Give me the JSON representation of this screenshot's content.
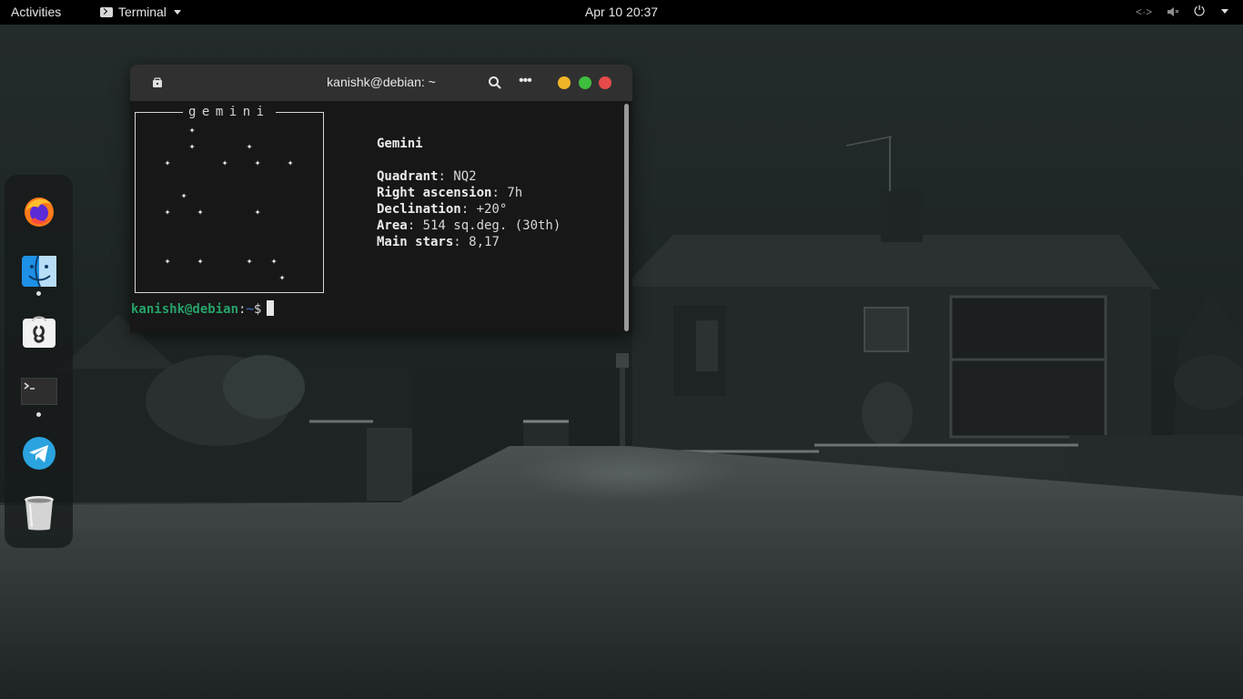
{
  "topbar": {
    "activities": "Activities",
    "app_name": "Terminal",
    "clock": "Apr 10  20:37",
    "tray": {
      "network_icon": "network-icon",
      "volume_icon": "volume-muted-icon",
      "power_icon": "power-icon"
    }
  },
  "dock": {
    "items": [
      {
        "name": "Firefox",
        "icon": "firefox-icon",
        "running": false
      },
      {
        "name": "Files",
        "icon": "finder-icon",
        "running": true
      },
      {
        "name": "Software",
        "icon": "software-bag-icon",
        "running": false
      },
      {
        "name": "Terminal",
        "icon": "terminal-icon",
        "running": true
      },
      {
        "name": "Telegram",
        "icon": "telegram-icon",
        "running": false
      },
      {
        "name": "Trash",
        "icon": "trash-icon",
        "running": false
      }
    ]
  },
  "terminal": {
    "title": "kanishk@debian: ~",
    "box_title": "gemini",
    "info": {
      "name": "Gemini",
      "quadrant_label": "Quadrant",
      "quadrant_value": ": NQ2",
      "ra_label": "Right ascension",
      "ra_value": ": 7h",
      "dec_label": "Declination",
      "dec_value": ": +20°",
      "area_label": "Area",
      "area_value": ": 514 sq.deg. (30th)",
      "stars_label": "Main stars",
      "stars_value": ": 8,17"
    },
    "prompt": {
      "user_host": "kanishk@debian",
      "sep": ":",
      "dir": "~",
      "symbol": "$"
    }
  },
  "colors": {
    "topbar_bg": "#000000",
    "terminal_bg": "#171717",
    "titlebar_bg": "#303030",
    "prompt_user": "#26a269",
    "prompt_dir": "#3d79d6",
    "minimize": "#f0b429",
    "maximize": "#3fbf3f",
    "close": "#e64a4a"
  }
}
